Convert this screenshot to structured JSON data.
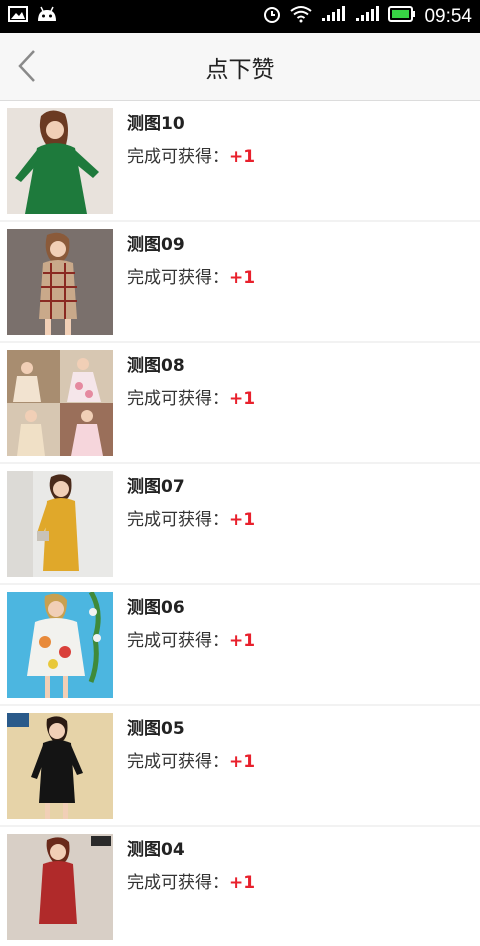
{
  "status_bar": {
    "time": "09:54",
    "left_icons": [
      "image-notification-icon",
      "android-icon"
    ],
    "right_icons": [
      "alarm-icon",
      "wifi-icon",
      "signal-icon",
      "battery-icon"
    ]
  },
  "header": {
    "title": "点下赞",
    "back_icon": "chevron-left-icon"
  },
  "items": [
    {
      "name": "测图10",
      "reward_label": "完成可获得：",
      "reward_value": "+1"
    },
    {
      "name": "测图09",
      "reward_label": "完成可获得：",
      "reward_value": "+1"
    },
    {
      "name": "测图08",
      "reward_label": "完成可获得：",
      "reward_value": "+1"
    },
    {
      "name": "测图07",
      "reward_label": "完成可获得：",
      "reward_value": "+1"
    },
    {
      "name": "测图06",
      "reward_label": "完成可获得：",
      "reward_value": "+1"
    },
    {
      "name": "测图05",
      "reward_label": "完成可获得：",
      "reward_value": "+1"
    },
    {
      "name": "测图04",
      "reward_label": "完成可获得：",
      "reward_value": "+1"
    }
  ],
  "colors": {
    "accent": "#e8202c",
    "status_bar": "#000000",
    "header_bg": "#f7f7f7"
  }
}
